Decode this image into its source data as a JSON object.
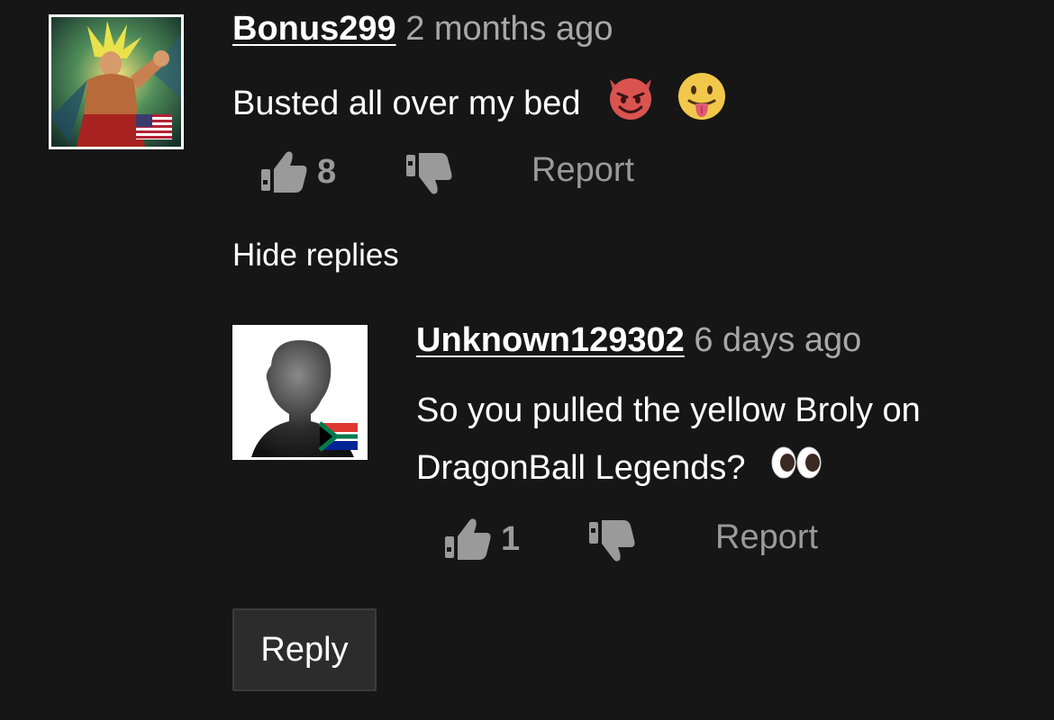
{
  "comment": {
    "username": "Bonus299",
    "time_ago": "2 months ago",
    "text": "Busted all over my bed",
    "emojis": [
      "smiling-imp-emoji",
      "tongue-out-emoji"
    ],
    "flag": "us-flag-icon",
    "likes": "8",
    "report_label": "Report"
  },
  "hide_replies_label": "Hide replies",
  "reply": {
    "username": "Unknown129302",
    "time_ago": "6 days ago",
    "text_line1": "So you pulled the yellow Broly on",
    "text_line2": "DragonBall Legends?",
    "emoji": "eyes-emoji",
    "flag": "south-africa-flag-icon",
    "likes": "1",
    "report_label": "Report"
  },
  "reply_button_label": "Reply",
  "colors": {
    "background": "#161616",
    "muted_text": "#9a9a9a",
    "timestamp": "#a8a8a8",
    "button_bg": "#2c2c2c"
  }
}
